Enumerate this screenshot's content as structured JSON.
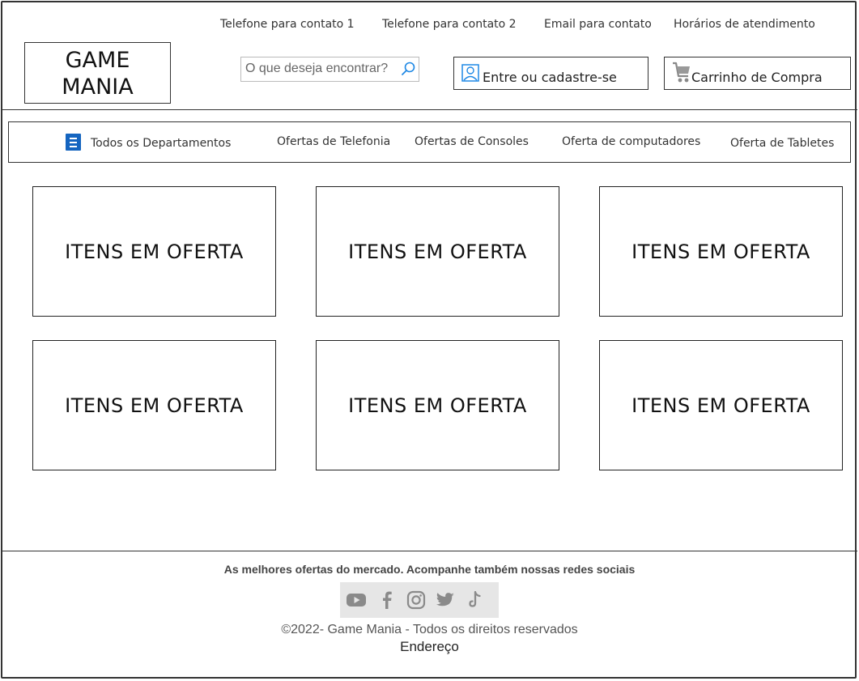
{
  "topbar": {
    "contact_1": "Telefone para contato 1",
    "contact_2": "Telefone para contato 2",
    "email": "Email para contato",
    "hours": "Horários de atendimento"
  },
  "logo": {
    "line1": "GAME",
    "line2": "MANIA"
  },
  "search": {
    "placeholder": "O que deseja encontrar?",
    "value": "",
    "icon": "search-icon"
  },
  "account": {
    "label": "Entre ou cadastre-se",
    "icon": "user-icon"
  },
  "cart": {
    "label": "Carrinho de Compra",
    "icon": "shopping-cart-icon"
  },
  "categories": {
    "all": "Todos os Departamentos",
    "all_icon": "menu-icon",
    "items": [
      "Ofertas de Telefonia",
      "Ofertas de Consoles",
      "Oferta de computadores",
      "Oferta de Tabletes"
    ]
  },
  "offers": [
    "ITENS EM OFERTA",
    "ITENS EM OFERTA",
    "ITENS EM OFERTA",
    "ITENS EM OFERTA",
    "ITENS EM OFERTA",
    "ITENS EM OFERTA"
  ],
  "footer": {
    "tagline": "As melhores ofertas do mercado. Acompanhe também nossas  redes sociais",
    "social": [
      "youtube-icon",
      "facebook-icon",
      "instagram-icon",
      "twitter-icon",
      "tiktok-icon"
    ],
    "copyright": "©2022- Game Mania - Todos os direitos reservados",
    "address": "Endereço"
  },
  "colors": {
    "accent": "#1565c0",
    "social_icon": "#8a8a8a",
    "social_bg": "#e6e6e6"
  }
}
